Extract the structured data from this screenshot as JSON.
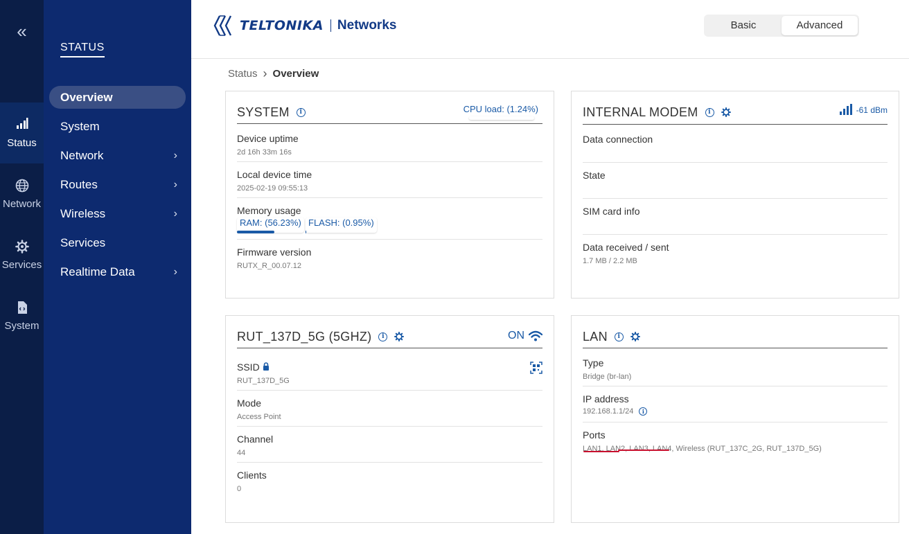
{
  "rail": {
    "collapse_glyph": "«",
    "items": [
      {
        "label": "Status",
        "icon": "status-bars-icon"
      },
      {
        "label": "Network",
        "icon": "globe-icon"
      },
      {
        "label": "Services",
        "icon": "gear-icon"
      },
      {
        "label": "System",
        "icon": "system-file-icon"
      }
    ]
  },
  "menu": {
    "heading": "STATUS",
    "items": [
      {
        "label": "Overview",
        "chevron": false
      },
      {
        "label": "System",
        "chevron": false
      },
      {
        "label": "Network",
        "chevron": true
      },
      {
        "label": "Routes",
        "chevron": true
      },
      {
        "label": "Wireless",
        "chevron": true
      },
      {
        "label": "Services",
        "chevron": false
      },
      {
        "label": "Realtime Data",
        "chevron": true
      }
    ]
  },
  "header": {
    "brand": "TELTONIKA",
    "brand_suffix": "Networks",
    "modes": [
      "Basic",
      "Advanced"
    ],
    "selected_mode": "Advanced"
  },
  "breadcrumb": {
    "root": "Status",
    "separator": "›",
    "current": "Overview"
  },
  "system_card": {
    "title": "SYSTEM",
    "cpu_load": "CPU load: (1.24%)",
    "rows": {
      "uptime_label": "Device uptime",
      "uptime_value": "2d 16h 33m 16s",
      "time_label": "Local device time",
      "time_value": "2025-02-19 09:55:13",
      "memory_label": "Memory usage",
      "ram": "RAM: (56.23%)",
      "flash": "FLASH: (0.95%)",
      "firmware_label": "Firmware version",
      "firmware_value": "RUTX_R_00.07.12"
    },
    "ram_fraction": 0.5623,
    "flash_fraction": 0.0095
  },
  "modem_card": {
    "title": "INTERNAL MODEM",
    "signal": "-61 dBm",
    "rows": {
      "data_connection_label": "Data connection",
      "state_label": "State",
      "sim_label": "SIM card info",
      "data_label": "Data received / sent",
      "data_value": "1.7 MB / 2.2 MB"
    }
  },
  "wifi_card": {
    "title": "RUT_137D_5G (5GHZ)",
    "status": "ON",
    "rows": {
      "ssid_label": "SSID",
      "ssid_value": "RUT_137D_5G",
      "mode_label": "Mode",
      "mode_value": "Access Point",
      "channel_label": "Channel",
      "channel_value": "44",
      "clients_label": "Clients",
      "clients_value": "0"
    }
  },
  "lan_card": {
    "title": "LAN",
    "rows": {
      "type_label": "Type",
      "type_value": "Bridge (br-lan)",
      "ip_label": "IP address",
      "ip_value": "192.168.1.1/24",
      "ports_label": "Ports",
      "ports_value": "LAN1, LAN2, LAN3, LAN4, Wireless (RUT_137C_2G, RUT_137D_5G)"
    }
  },
  "colors": {
    "accent": "#1a5aa6",
    "rail_bg": "#0b1e47",
    "menu_bg": "#0d2a6f",
    "annotation": "#c8102e"
  }
}
